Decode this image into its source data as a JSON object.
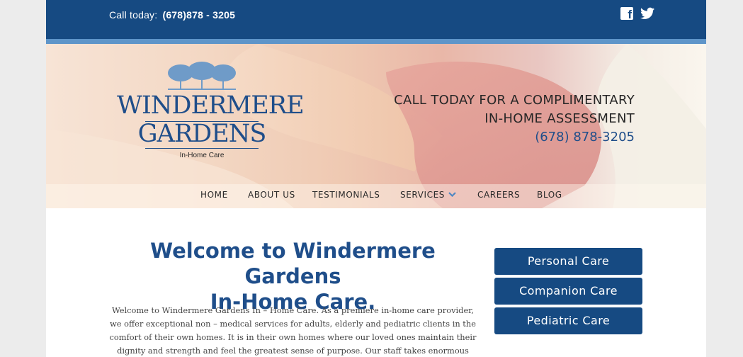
{
  "topbar": {
    "call_label": "Call today:",
    "phone": "(678)878 - 3205",
    "social": [
      {
        "icon": "facebook-icon",
        "glyph": "f"
      },
      {
        "icon": "twitter-icon"
      }
    ]
  },
  "logo": {
    "line1": "WINDERMERE",
    "line2": "GARDENS",
    "tagline": "In-Home Care"
  },
  "promo": {
    "line1": "CALL TODAY FOR A COMPLIMENTARY",
    "line2": "IN-HOME ASSESSMENT",
    "phone": "(678) 878-3205"
  },
  "nav": {
    "items": [
      {
        "label": "HOME"
      },
      {
        "label": "ABOUT US"
      },
      {
        "label": "TESTIMONIALS"
      },
      {
        "label": "SERVICES"
      },
      {
        "label": "CAREERS"
      },
      {
        "label": "BLOG"
      }
    ]
  },
  "main": {
    "title_line1": "Welcome to Windermere Gardens",
    "title_line2": "In-Home Care.",
    "intro": "Welcome to Windermere Gardens In – Home Care. As a premiere in-home care provider, we offer exceptional non – medical services for adults, elderly and pediatric clients in the comfort of their own homes. It is in their own homes where our loved ones maintain their dignity and strength and feel the greatest sense of purpose. Our staff takes enormous pride"
  },
  "sidebar": {
    "services": [
      {
        "label": "Personal Care"
      },
      {
        "label": "Companion Care"
      },
      {
        "label": "Pediatric Care"
      }
    ]
  },
  "colors": {
    "brand_blue": "#164a82",
    "accent_blue": "#5e95c9",
    "page_bg": "#ececec"
  }
}
